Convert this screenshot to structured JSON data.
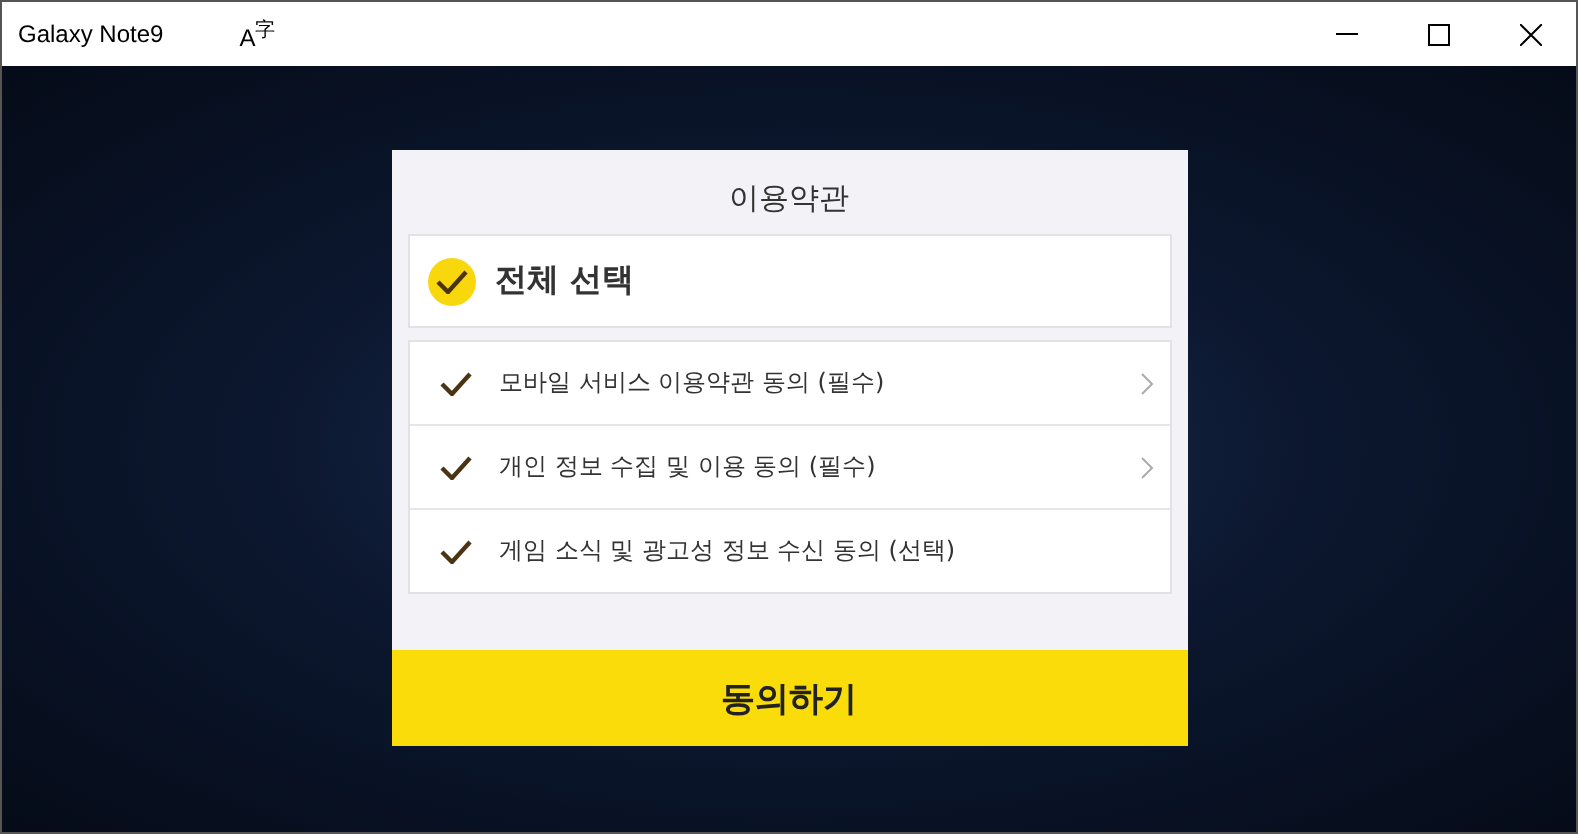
{
  "window": {
    "title": "Galaxy Note9",
    "language_button": "A$^{字}$"
  },
  "dialog": {
    "title": "이용약관",
    "select_all": {
      "label": "전체 선택",
      "checked": true
    },
    "items": [
      {
        "label": "모바일 서비스 이용약관 동의 (필수)",
        "checked": true,
        "has_arrow": true
      },
      {
        "label": "개인 정보 수집 및 이용 동의 (필수)",
        "checked": true,
        "has_arrow": true
      },
      {
        "label": "게임 소식 및 광고성 정보 수신 동의 (선택)",
        "checked": true,
        "has_arrow": false
      }
    ],
    "confirm_button": "동의하기"
  }
}
